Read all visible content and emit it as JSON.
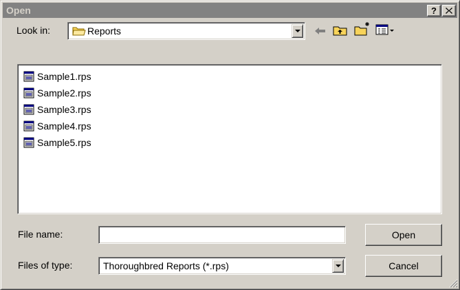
{
  "window": {
    "title": "Open",
    "help_label": "?",
    "close_label": "✕"
  },
  "look_in": {
    "label": "Look in:",
    "value": "Reports"
  },
  "toolbar": {
    "back_icon": "back-arrow-icon",
    "up_icon": "up-folder-icon",
    "new_folder_icon": "new-folder-icon",
    "view_icon": "view-menu-icon"
  },
  "files": [
    {
      "name": "Sample1.rps"
    },
    {
      "name": "Sample2.rps"
    },
    {
      "name": "Sample3.rps"
    },
    {
      "name": "Sample4.rps"
    },
    {
      "name": "Sample5.rps"
    }
  ],
  "file_name": {
    "label": "File name:",
    "value": ""
  },
  "file_type": {
    "label": "Files of type:",
    "value": "Thoroughbred Reports (*.rps)"
  },
  "buttons": {
    "open": "Open",
    "cancel": "Cancel"
  },
  "colors": {
    "face": "#d4d0c8",
    "title_inactive": "#828282",
    "folder": "#f7d35a"
  }
}
